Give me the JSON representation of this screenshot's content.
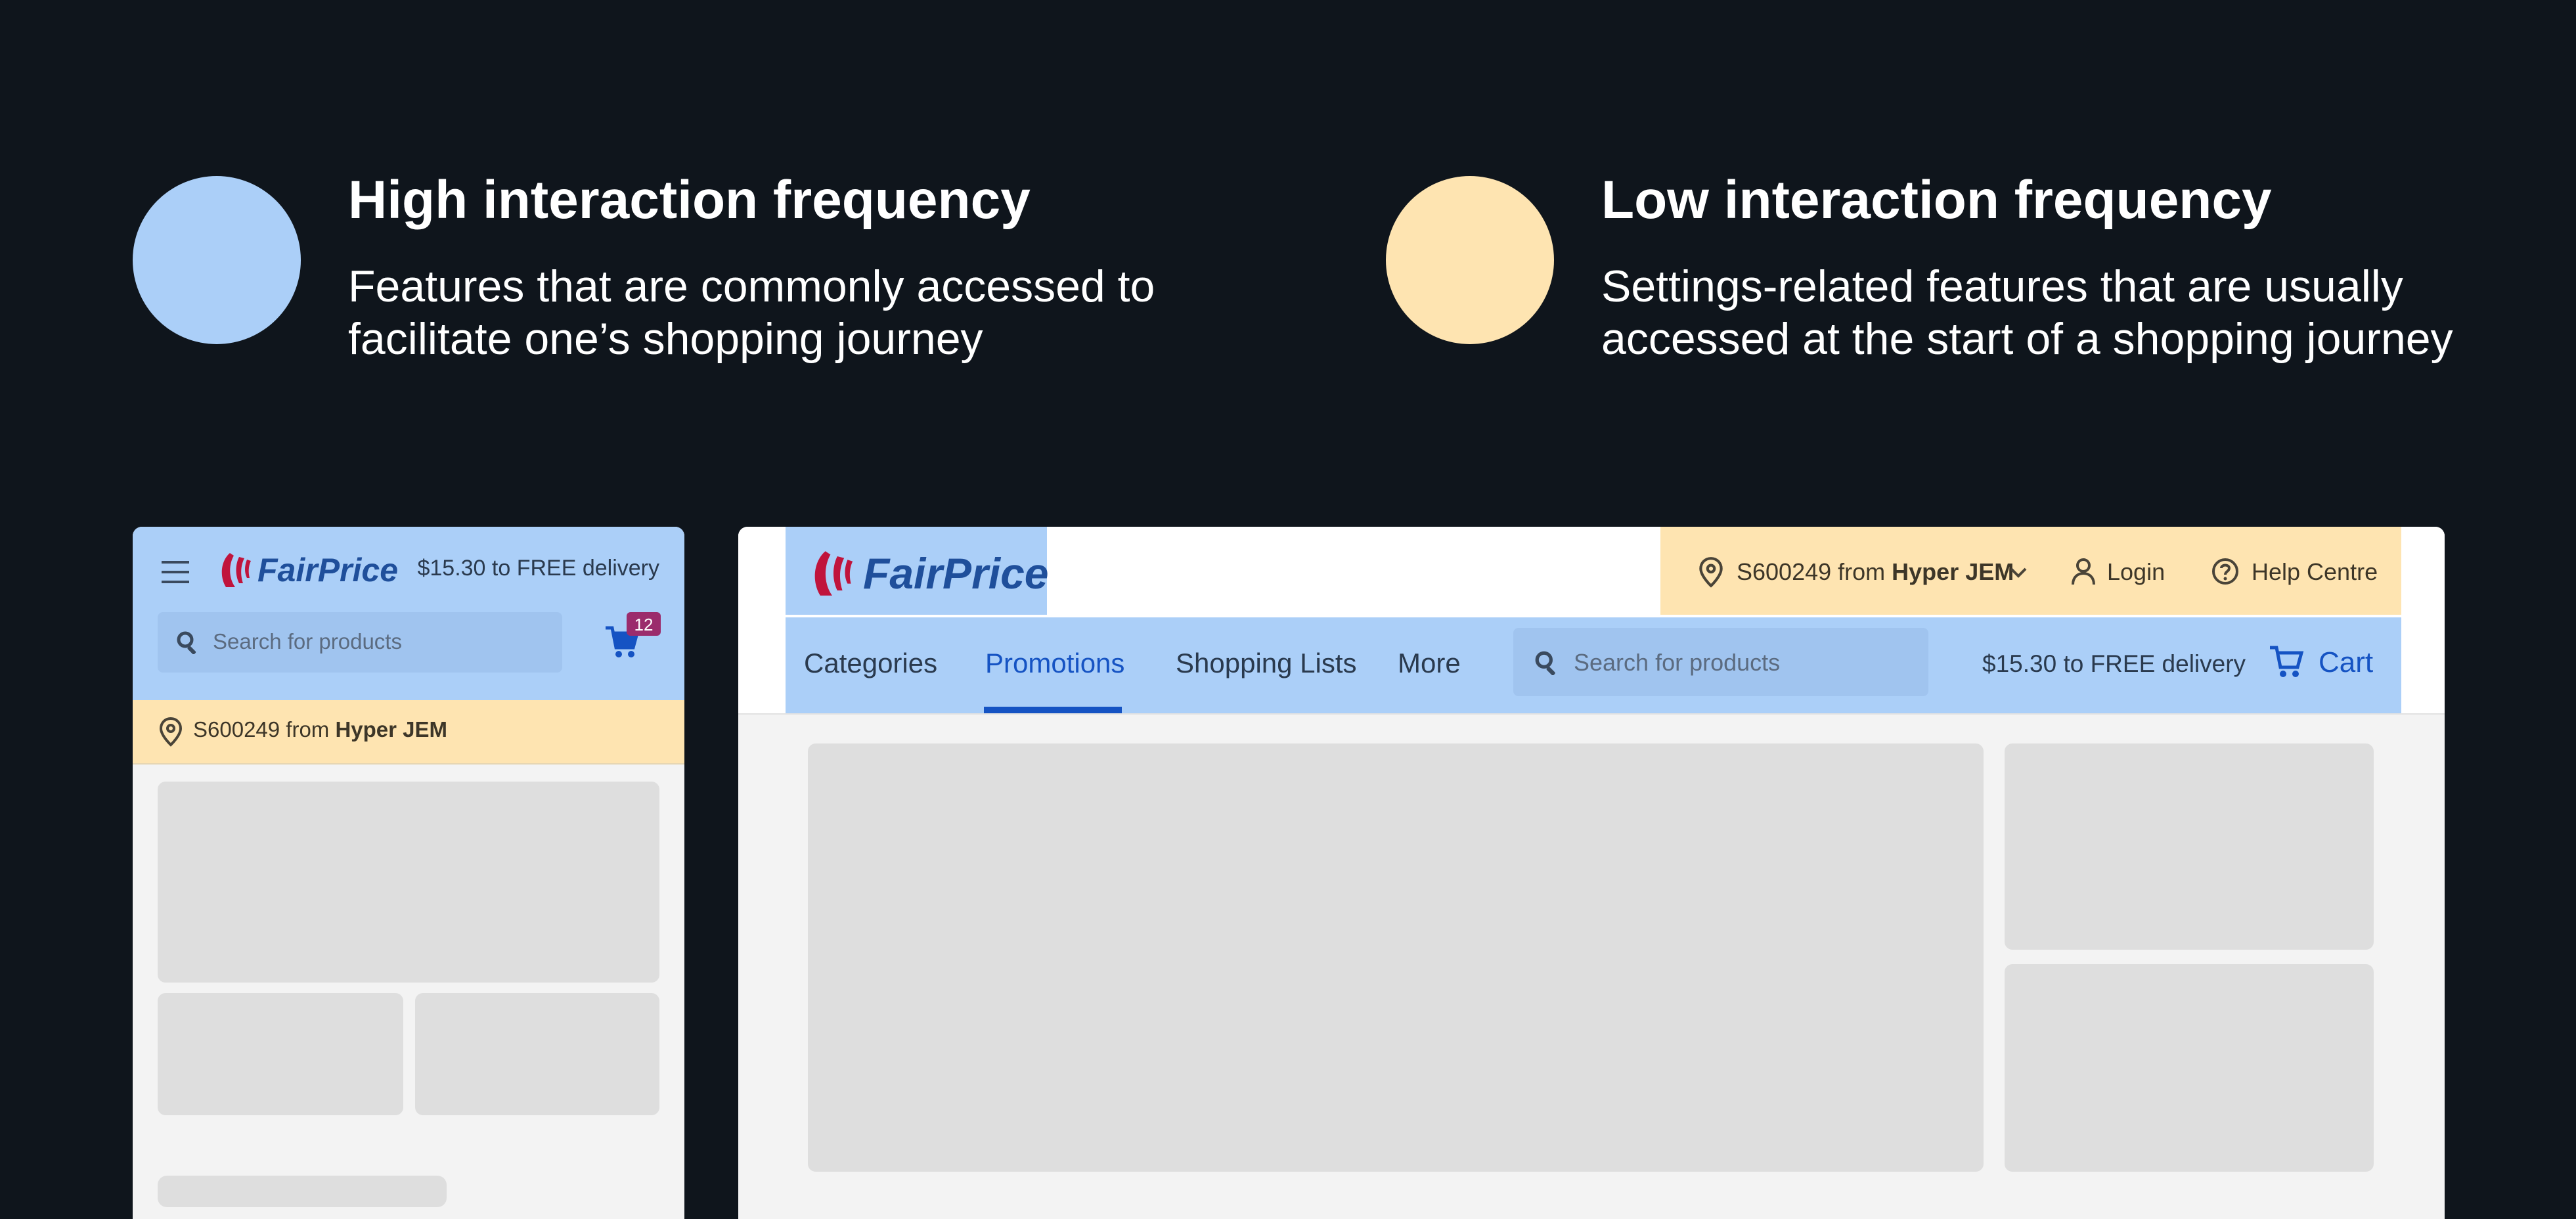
{
  "colors": {
    "background": "#0f151c",
    "high": "#abcff8",
    "low": "#fee4b1",
    "brand_blue": "#1f4f9b",
    "brand_red": "#c0143c",
    "active_blue": "#1553c3",
    "badge": "#9b2c6c",
    "skeleton": "#dedede",
    "page_bg": "#f3f3f3"
  },
  "legend": {
    "high": {
      "title": "High interaction frequency",
      "line1": "Features that are commonly accessed to",
      "line2": "facilitate one’s shopping journey"
    },
    "low": {
      "title": "Low interaction frequency",
      "line1": "Settings-related features that are usually",
      "line2": "accessed at the start of a shopping journey"
    }
  },
  "mobile": {
    "logo_text": "FairPrice",
    "delivery": "$15.30 to FREE delivery",
    "search_placeholder": "Search for products",
    "cart_badge": "12",
    "location_prefix": "S600249 from ",
    "location_store": "Hyper JEM"
  },
  "desktop": {
    "logo_text": "FairPrice",
    "location_prefix": "S600249 from ",
    "location_store": "Hyper JEM",
    "login": "Login",
    "help": "Help Centre",
    "nav": {
      "categories": "Categories",
      "promotions": "Promotions",
      "shopping_lists": "Shopping Lists",
      "more": "More"
    },
    "search_placeholder": "Search for products",
    "delivery": "$15.30 to FREE delivery",
    "cart": "Cart"
  }
}
